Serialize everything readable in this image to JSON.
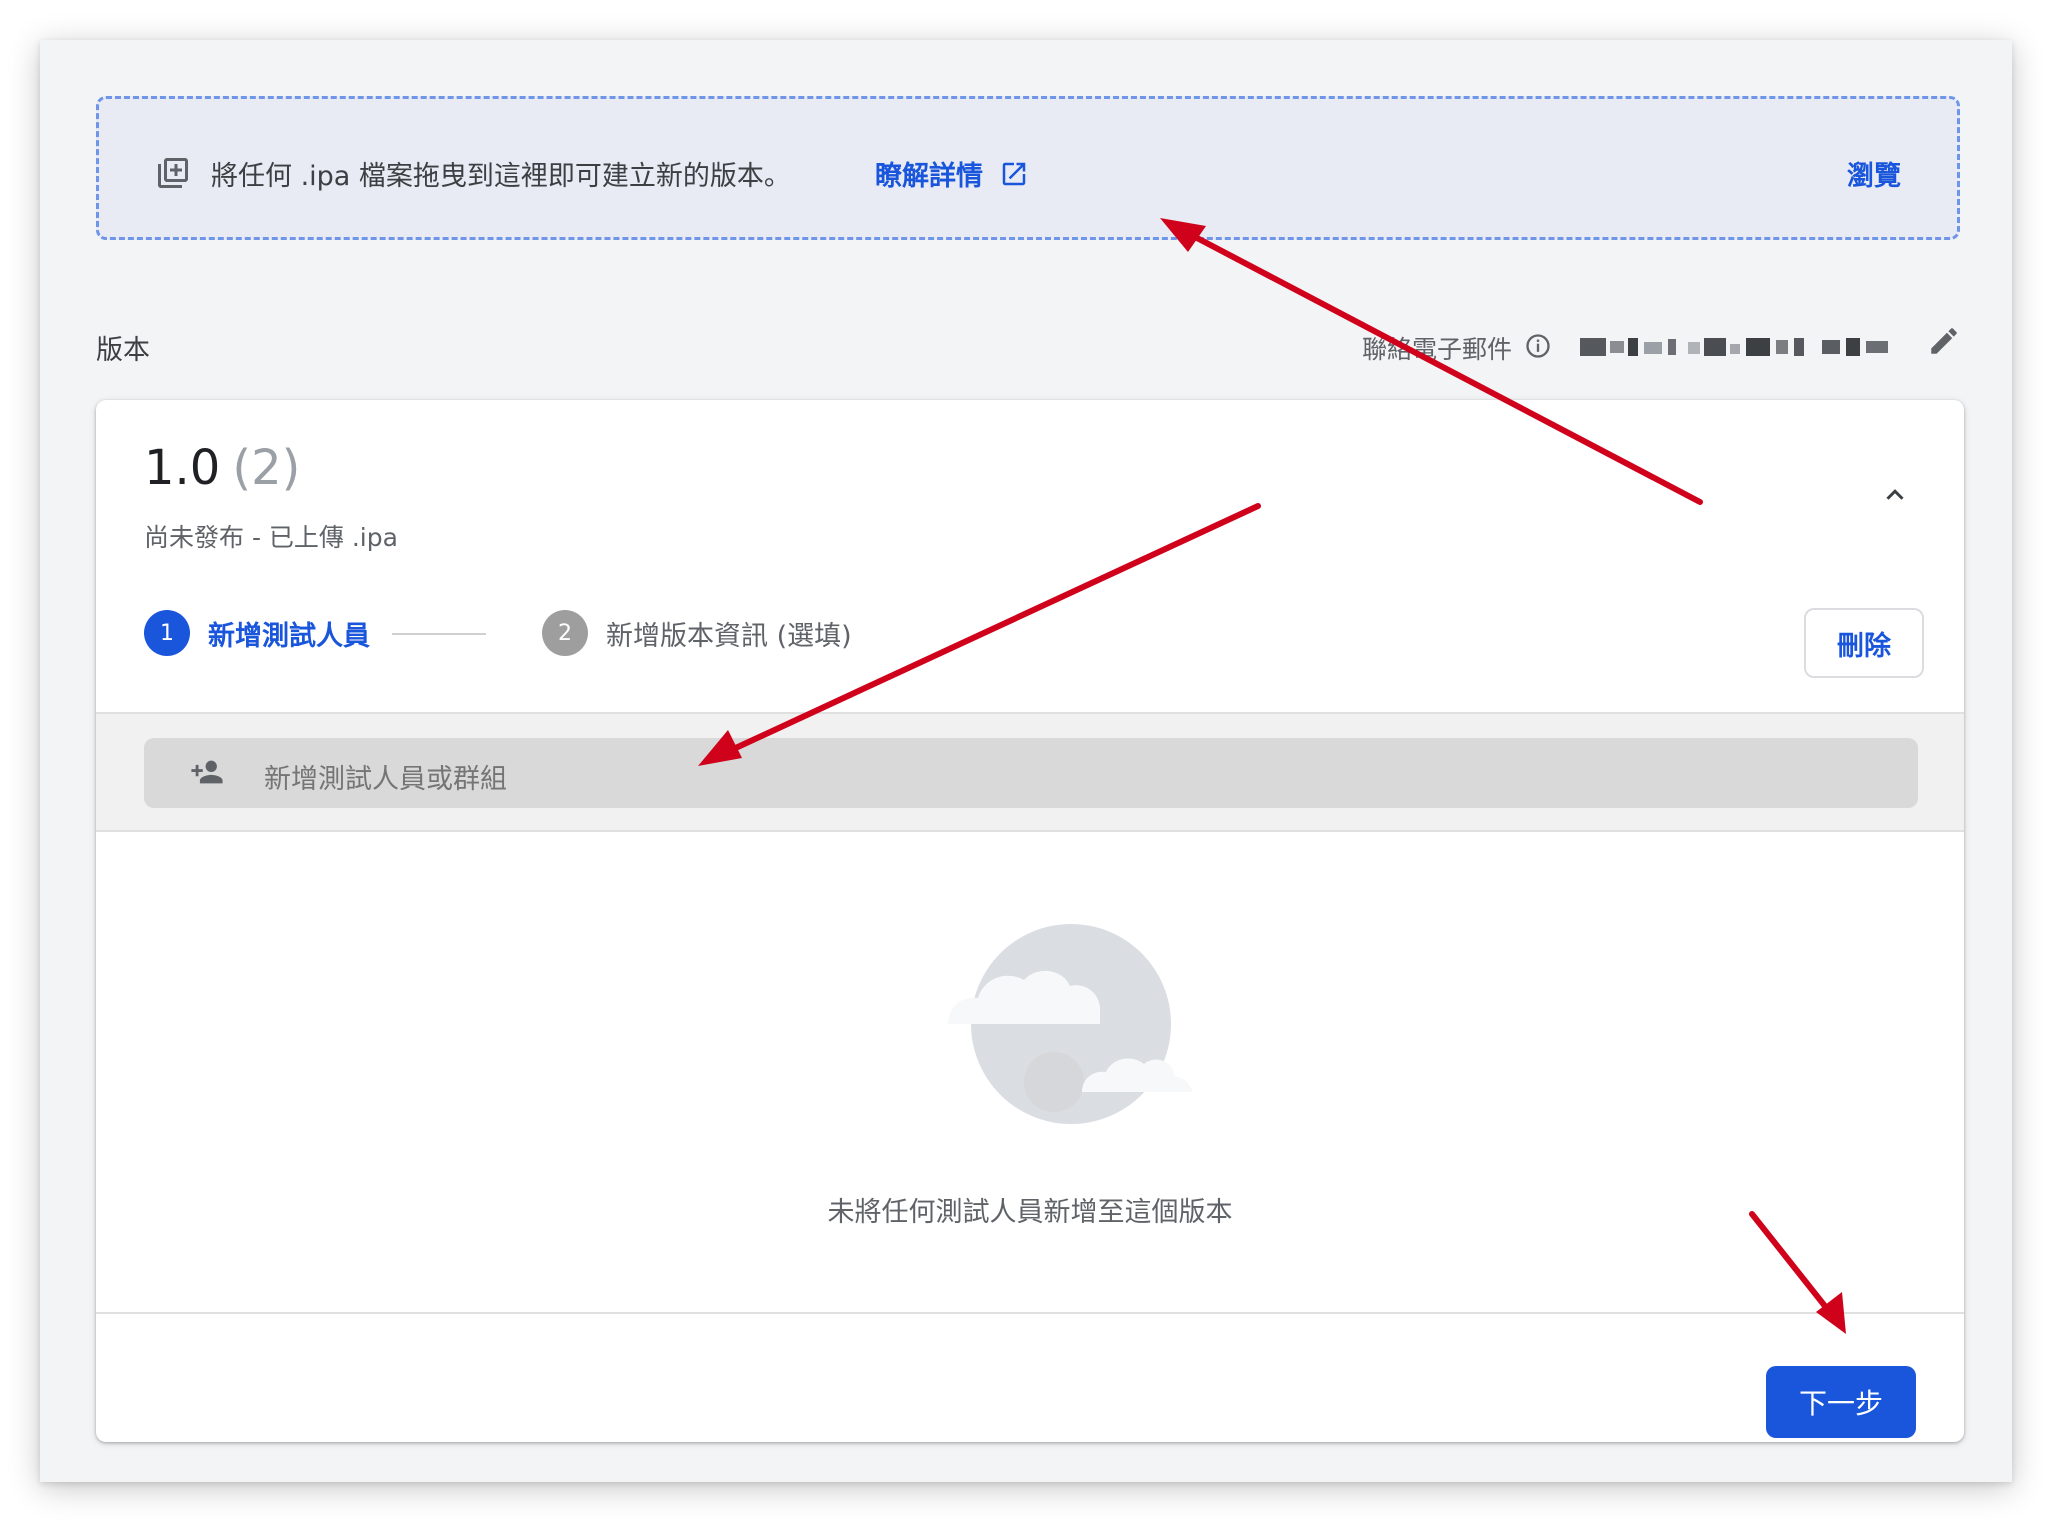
{
  "upload": {
    "text": "將任何 .ipa 檔案拖曳到這裡即可建立新的版本。",
    "learn_more": "瞭解詳情",
    "browse": "瀏覽"
  },
  "section": {
    "label": "版本",
    "contact_label": "聯絡電子郵件"
  },
  "release": {
    "version": "1.0",
    "build": "(2)",
    "status": "尚未發布 - 已上傳 .ipa",
    "steps": [
      {
        "number": "1",
        "label": "新增測試人員"
      },
      {
        "number": "2",
        "label": "新增版本資訊 (選填)"
      }
    ],
    "delete_label": "刪除",
    "search_placeholder": "新增測試人員或群組",
    "empty_message": "未將任何測試人員新增至這個版本",
    "next_label": "下一步"
  },
  "colors": {
    "accent": "#1a56db",
    "annotation_arrow": "#d0021b",
    "dropzone_border": "#6f95e8"
  },
  "icons": {
    "add_file": "add-to-library-icon",
    "external_link": "open-in-new-icon",
    "info": "info-icon",
    "edit": "pencil-icon",
    "collapse": "chevron-up-icon",
    "add_person": "person-add-icon"
  }
}
